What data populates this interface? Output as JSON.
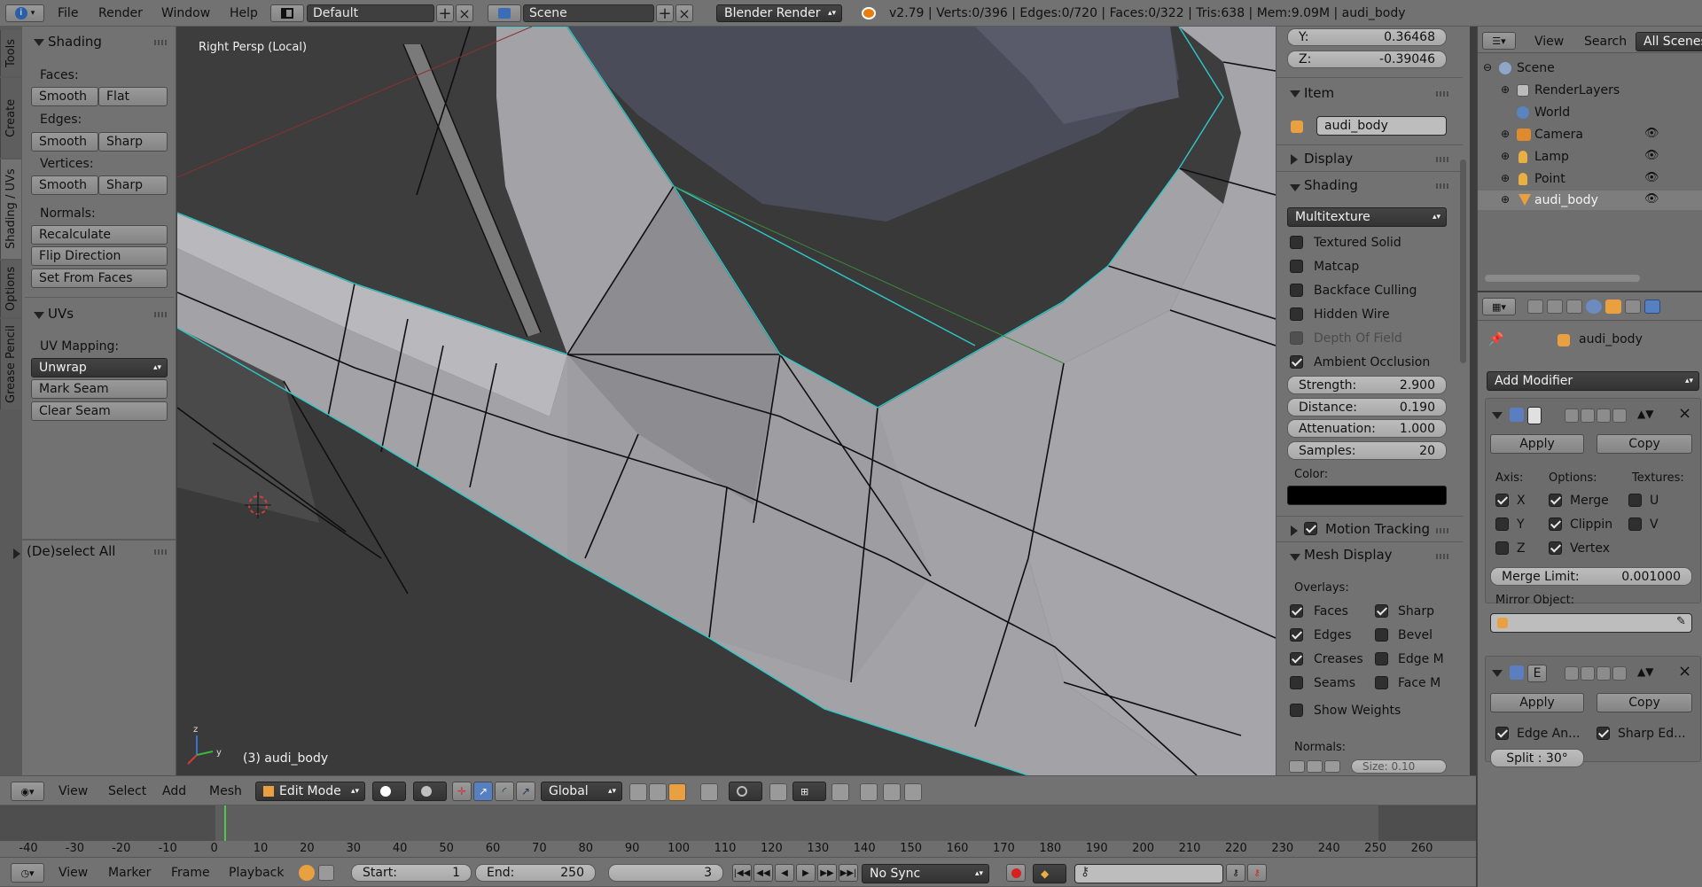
{
  "topbar": {
    "menus": [
      "File",
      "Render",
      "Window",
      "Help"
    ],
    "layout_name": "Default",
    "scene_name": "Scene",
    "engine": "Blender Render",
    "stats": "v2.79 | Verts:0/396 | Edges:0/720 | Faces:0/322 | Tris:638 | Mem:9.09M | audi_body"
  },
  "tool_tabs": [
    "Tools",
    "Create",
    "Shading / UVs",
    "Options",
    "Grease Pencil"
  ],
  "shading_panel": {
    "title": "Shading",
    "faces_label": "Faces:",
    "edges_label": "Edges:",
    "vertices_label": "Vertices:",
    "smooth": "Smooth",
    "flat": "Flat",
    "sharp": "Sharp",
    "normals_label": "Normals:",
    "recalculate": "Recalculate",
    "flip_direction": "Flip Direction",
    "set_from_faces": "Set From Faces"
  },
  "uvs_panel": {
    "title": "UVs",
    "mapping_label": "UV Mapping:",
    "unwrap": "Unwrap",
    "mark_seam": "Mark Seam",
    "clear_seam": "Clear Seam"
  },
  "operator_panel": {
    "title": "(De)select All"
  },
  "viewport": {
    "view_name": "Right Persp (Local)",
    "object_label": "(3) audi_body",
    "colors": {
      "bg": "#3d3d3d",
      "mesh": "#a9a9ad",
      "wire": "#0f0f0f",
      "select": "#2fc7c7",
      "hole": "#4b4c5a"
    }
  },
  "properties_n": {
    "y_label": "Y:",
    "y_value": "0.36468",
    "z_label": "Z:",
    "z_value": "-0.39046",
    "item_title": "Item",
    "item_name": "audi_body",
    "display_title": "Display",
    "shading_title": "Shading",
    "shading_mode": "Multitexture",
    "opts": [
      "Textured Solid",
      "Matcap",
      "Backface Culling",
      "Hidden Wire",
      "Depth Of Field",
      "Ambient Occlusion"
    ],
    "strength_label": "Strength:",
    "strength": "2.900",
    "distance_label": "Distance:",
    "distance": "0.190",
    "attenuation_label": "Attenuation:",
    "attenuation": "1.000",
    "samples_label": "Samples:",
    "samples": "20",
    "color_label": "Color:",
    "motion_tracking": "Motion Tracking",
    "mesh_display": "Mesh Display",
    "overlays_label": "Overlays:",
    "overlays": [
      "Faces",
      "Sharp",
      "Edges",
      "Bevel",
      "Creases",
      "Edge M",
      "Seams",
      "Face M"
    ],
    "show_weights": "Show Weights",
    "normals_label": "Normals:",
    "size_label": "Size: 0.10"
  },
  "outliner": {
    "view": "View",
    "search": "Search",
    "all_scenes": "All Scenes",
    "items": [
      "Scene",
      "RenderLayers",
      "World",
      "Camera",
      "Lamp",
      "Point",
      "audi_body"
    ]
  },
  "modifiers": {
    "object_name": "audi_body",
    "add_modifier": "Add Modifier",
    "apply": "Apply",
    "copy": "Copy",
    "axis_label": "Axis:",
    "options_label": "Options:",
    "textures_label": "Textures:",
    "x": "X",
    "y": "Y",
    "z": "Z",
    "merge": "Merge",
    "clipping": "Clippin",
    "vertex": "Vertex",
    "u": "U",
    "v": "V",
    "merge_limit_label": "Merge Limit:",
    "merge_limit": "0.001000",
    "mirror_object_label": "Mirror Object:",
    "edge_angle": "Edge An...",
    "sharp_edges": "Sharp Ed...",
    "split": "Split : 30°",
    "e_label": "E"
  },
  "view3d_header": {
    "menus": [
      "View",
      "Select",
      "Add",
      "Mesh"
    ],
    "mode": "Edit Mode",
    "orientation": "Global"
  },
  "timeline": {
    "ticks": [
      "-40",
      "-30",
      "-20",
      "-10",
      "0",
      "10",
      "20",
      "30",
      "40",
      "50",
      "60",
      "70",
      "80",
      "90",
      "100",
      "110",
      "120",
      "130",
      "140",
      "150",
      "160",
      "170",
      "180",
      "190",
      "200",
      "210",
      "220",
      "230",
      "240",
      "250",
      "260"
    ],
    "menus": [
      "View",
      "Marker",
      "Frame",
      "Playback"
    ],
    "start_label": "Start:",
    "start": "1",
    "end_label": "End:",
    "end": "250",
    "current": "3",
    "sync": "No Sync"
  }
}
